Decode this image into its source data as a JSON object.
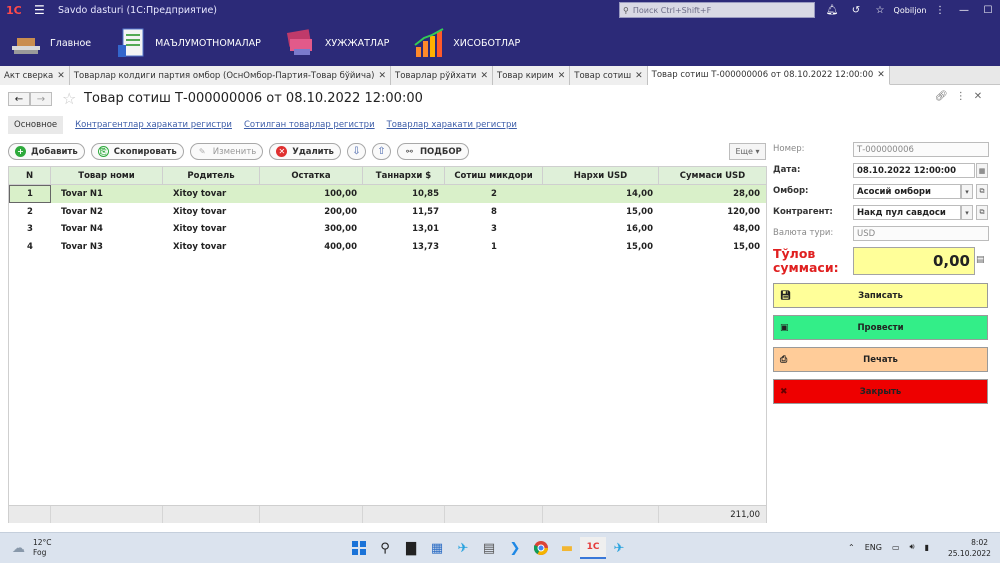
{
  "titlebar": {
    "logo": "1С",
    "title": "Savdo dasturi  (1С:Предприятие)",
    "search_placeholder": "Поиск Ctrl+Shift+F",
    "user": "Qobiljon"
  },
  "main_menu": {
    "items": [
      {
        "label": "Главное"
      },
      {
        "label": "МАЪЛУМОТНОМАЛАР"
      },
      {
        "label": "ХУЖЖАТЛАР"
      },
      {
        "label": "ХИСОБОТЛАР"
      }
    ]
  },
  "tabs": [
    {
      "label": "Акт сверка"
    },
    {
      "label": "Товарлар колдиги партия омбор (ОснОмбор-Партия-Товар бўйича)"
    },
    {
      "label": "Товарлар рўйхати"
    },
    {
      "label": "Товар кирим"
    },
    {
      "label": "Товар сотиш"
    },
    {
      "label": "Товар сотиш Т-000000006 от 08.10.2022 12:00:00"
    }
  ],
  "document": {
    "title": "Товар сотиш Т-000000006 от 08.10.2022 12:00:00",
    "subnav": [
      "Основное",
      "Контрагентлар харакати регистри",
      "Сотилган товарлар регистри",
      "Товарлар харакати регистри"
    ]
  },
  "toolbar": {
    "add": "Добавить",
    "copy": "Скопировать",
    "edit": "Изменить",
    "delete": "Удалить",
    "podbor": "ПОДБОР",
    "more": "Еще"
  },
  "table": {
    "columns": [
      "N",
      "Товар номи",
      "Родитель",
      "Остатка",
      "Таннархи $",
      "Сотиш микдори",
      "Нархи USD",
      "Суммаси USD"
    ],
    "rows": [
      [
        "1",
        "Tovar N1",
        "Xitoy tovar",
        "100,00",
        "10,85",
        "2",
        "14,00",
        "28,00"
      ],
      [
        "2",
        "Tovar N2",
        "Xitoy tovar",
        "200,00",
        "11,57",
        "8",
        "15,00",
        "120,00"
      ],
      [
        "3",
        "Tovar N4",
        "Xitoy tovar",
        "300,00",
        "13,01",
        "3",
        "16,00",
        "48,00"
      ],
      [
        "4",
        "Tovar N3",
        "Xitoy tovar",
        "400,00",
        "13,73",
        "1",
        "15,00",
        "15,00"
      ]
    ],
    "total": "211,00"
  },
  "form": {
    "number_label": "Номер:",
    "number_value": "Т-000000006",
    "date_label": "Дата:",
    "date_value": "08.10.2022 12:00:00",
    "warehouse_label": "Омбор:",
    "warehouse_value": "Асосий омбори",
    "counterparty_label": "Контрагент:",
    "counterparty_value": "Накд пул савдоси",
    "currency_label": "Валюта тури:",
    "currency_value": "USD",
    "payment_label": "Тўлов суммаси:",
    "payment_value": "0,00"
  },
  "actions": {
    "save": "Записать",
    "post": "Провести",
    "print": "Печать",
    "close": "Закрыть"
  },
  "colors": {
    "menu_bg": "#2c2a78",
    "post_green": "#33ee88",
    "print_orange": "#ffcc99",
    "close_red": "#ee0000",
    "save_yellow": "#ffff99",
    "payment_red": "#e02020"
  },
  "taskbar": {
    "temp": "12°C",
    "weather": "Fog",
    "lang": "ENG",
    "time": "8:02",
    "date": "25.10.2022"
  }
}
